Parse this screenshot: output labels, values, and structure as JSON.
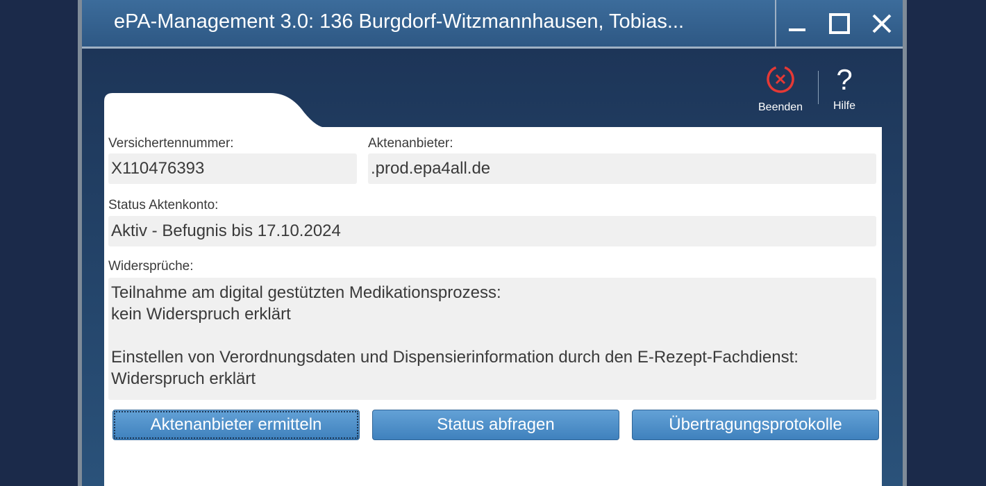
{
  "window": {
    "title": "ePA-Management 3.0: 136 Burgdorf-Witzmannhausen, Tobias..."
  },
  "toolbar": {
    "quit_label": "Beenden",
    "help_label": "Hilfe",
    "help_glyph": "?"
  },
  "form": {
    "insurance_number_label": "Versichertennummer:",
    "insurance_number_value": "X110476393",
    "provider_label": "Aktenanbieter:",
    "provider_value": ".prod.epa4all.de",
    "status_label": "Status Aktenkonto:",
    "status_value": "Aktiv - Befugnis bis 17.10.2024",
    "objections_label": "Widersprüche:",
    "objections": [
      "Teilnahme am digital gestützten Medikationsprozess:",
      "kein Widerspruch erklärt",
      "",
      "Einstellen von Verordnungsdaten und Dispensierinformation durch den E-Rezept-Fachdienst:",
      "Widerspruch erklärt"
    ]
  },
  "buttons": {
    "determine_provider": "Aktenanbieter ermitteln",
    "query_status": "Status abfragen",
    "transfer_logs": "Übertragungsprotokolle"
  },
  "icons": {
    "quit": "close-circle-icon",
    "help": "question-icon",
    "minimize": "minimize-icon",
    "maximize": "maximize-icon",
    "close": "close-icon"
  },
  "colors": {
    "quit_icon": "#e53935",
    "button": "#4f92cc",
    "titlebar": "#34618f"
  }
}
